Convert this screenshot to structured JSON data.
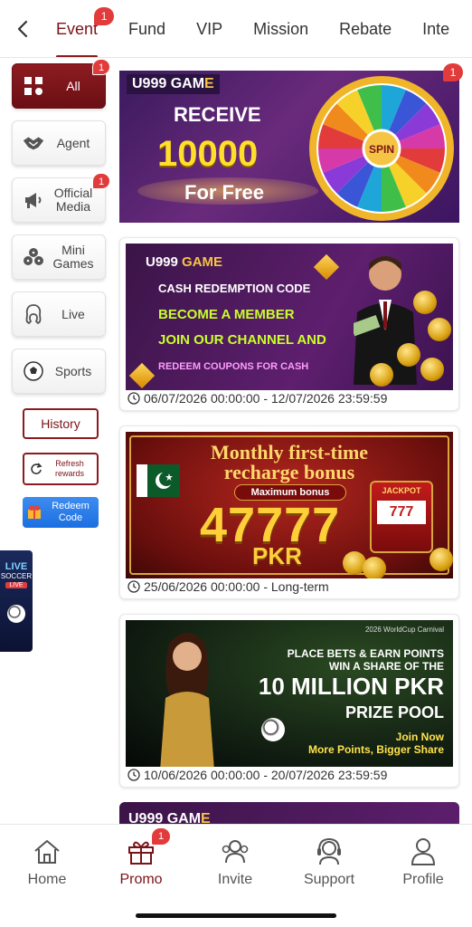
{
  "top_tabs": {
    "items": [
      {
        "label": "Event",
        "active": true,
        "badge": "1"
      },
      {
        "label": "Fund"
      },
      {
        "label": "VIP"
      },
      {
        "label": "Mission"
      },
      {
        "label": "Rebate"
      },
      {
        "label": "Inte"
      }
    ]
  },
  "categories": [
    {
      "label": "All",
      "active": true,
      "badge": "1",
      "icon": "grid-icon"
    },
    {
      "label": "Agent",
      "icon": "handshake-icon"
    },
    {
      "label": "Official Media",
      "badge": "1",
      "icon": "megaphone-icon"
    },
    {
      "label": "Mini Games",
      "icon": "dice-icon"
    },
    {
      "label": "Live",
      "icon": "woman-face-icon"
    },
    {
      "label": "Sports",
      "icon": "soccer-ball-icon"
    }
  ],
  "side_actions": {
    "history": "History",
    "refresh": "Refresh rewards",
    "redeem": "Redeem Code"
  },
  "live_float": {
    "line1": "LIVE",
    "line2": "SOCCER",
    "line3": "LIVE"
  },
  "hero": {
    "brand_a": "U999 GAM",
    "brand_b": "E",
    "line1": "RECEIVE",
    "line2": "10000",
    "line3": "For Free",
    "wheel_center": "SPIN",
    "badge": "1"
  },
  "promos": [
    {
      "brand_a": "U999 ",
      "brand_b": "GAME",
      "l1": "CASH REDEMPTION CODE",
      "l2": "BECOME A MEMBER",
      "l3": "JOIN OUR CHANNEL AND",
      "l4": "REDEEM COUPONS FOR CASH",
      "date": "06/07/2026 00:00:00 - 12/07/2026 23:59:59"
    },
    {
      "h1": "Monthly first-time",
      "h2": "recharge bonus",
      "pill": "Maximum bonus",
      "amount": "47777",
      "currency": "PKR",
      "jackpot": "JACKPOT",
      "slot": "777",
      "date": "25/06/2026 00:00:00 - Long-term"
    },
    {
      "cap": "2026 WorldCup Carnival",
      "t1a": "PLACE BETS & EARN POINTS",
      "t1b": "WIN A SHARE OF THE",
      "t2": "10 MILLION PKR",
      "t3": "PRIZE POOL",
      "t4a": "Join Now",
      "t4b": "More Points, Bigger Share",
      "date": "10/06/2026 00:00:00 - 20/07/2026 23:59:59"
    }
  ],
  "peek": {
    "brand_a": "U999 GAM",
    "brand_b": "E"
  },
  "bottom_nav": [
    {
      "label": "Home",
      "icon": "home-icon"
    },
    {
      "label": "Promo",
      "icon": "gift-icon",
      "active": true,
      "badge": "1"
    },
    {
      "label": "Invite",
      "icon": "people-icon"
    },
    {
      "label": "Support",
      "icon": "headset-icon"
    },
    {
      "label": "Profile",
      "icon": "person-icon"
    }
  ],
  "colors": {
    "brand": "#8b1b1f",
    "badge": "#e23b3b",
    "redeem": "#1c6fe0"
  }
}
